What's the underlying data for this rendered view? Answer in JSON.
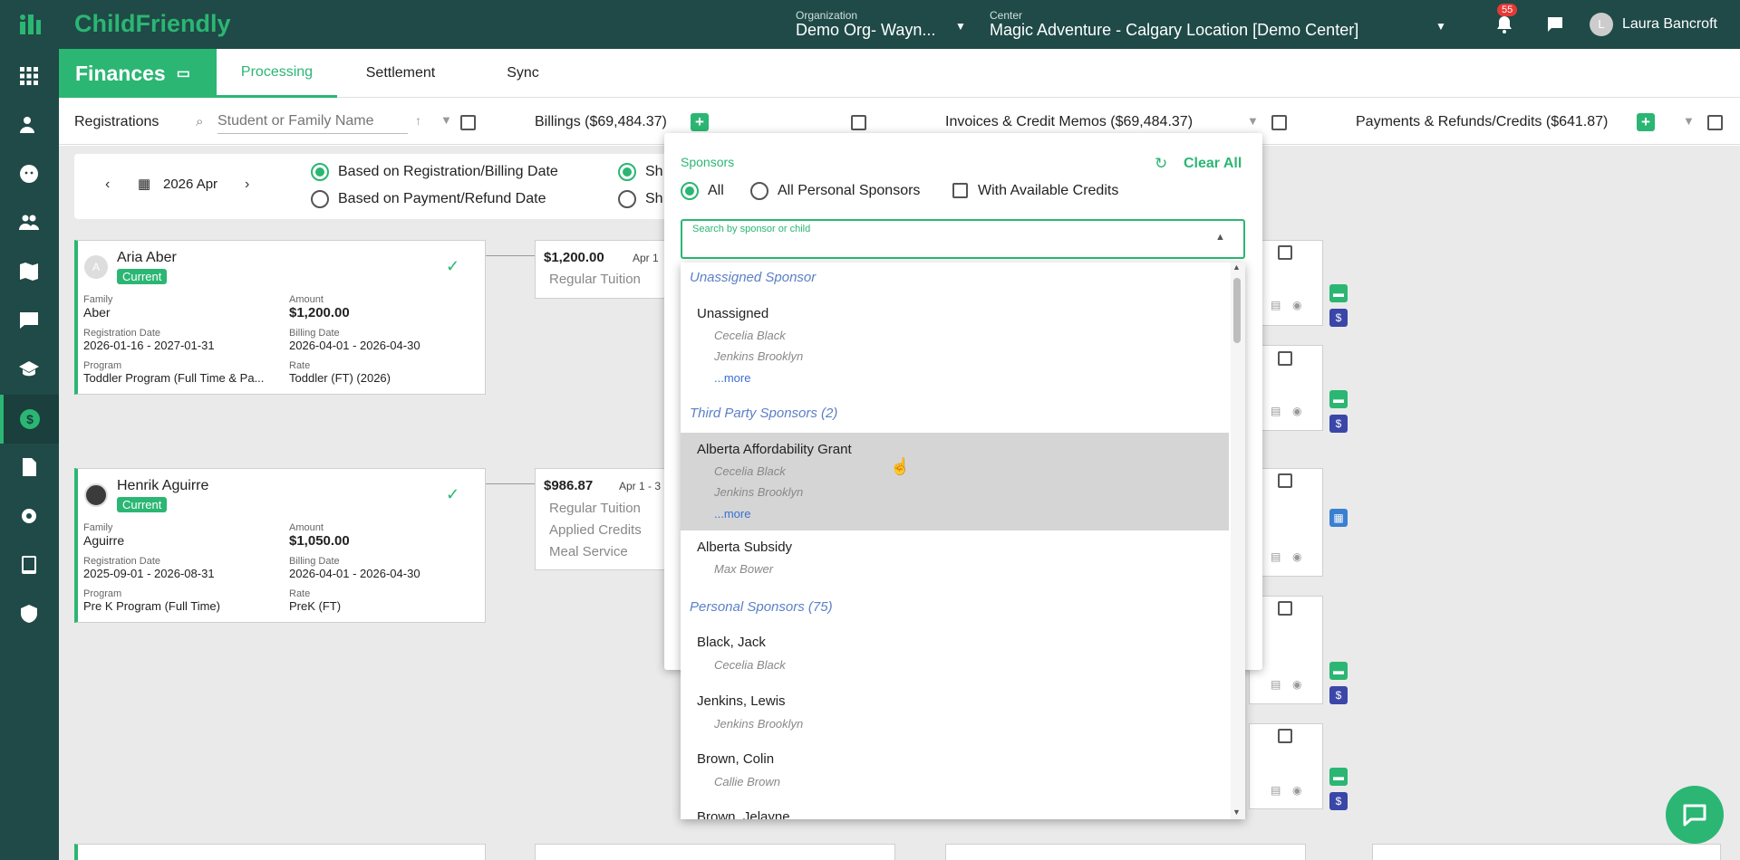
{
  "app": {
    "logo": "ChildFriendly",
    "org_label": "Organization",
    "org_value": "Demo Org- Wayn...",
    "center_label": "Center",
    "center_value": "Magic Adventure - Calgary Location [Demo Center]",
    "notif_count": "55",
    "user_initial": "L",
    "user_name": "Laura Bancroft"
  },
  "colors": {
    "brand": "#2bb673",
    "nav_bg": "#1f4a47",
    "link": "#3a6fd0"
  },
  "section": {
    "title": "Finances",
    "tabs": [
      "Processing",
      "Settlement",
      "Sync"
    ]
  },
  "filters": {
    "registrations": "Registrations",
    "search_placeholder": "Student or Family Name",
    "billings": "Billings ($69,484.37)",
    "invoices": "Invoices & Credit Memos ($69,484.37)",
    "payments": "Payments & Refunds/Credits ($641.87)"
  },
  "period": {
    "month": "2026 Apr",
    "opt1": "Based on Registration/Billing Date",
    "opt2": "Based on Payment/Refund Date",
    "opt3": "Sh",
    "opt4": "Sh"
  },
  "cards": [
    {
      "initial": "A",
      "name": "Aria Aber",
      "status": "Current",
      "family_lbl": "Family",
      "family": "Aber",
      "amount_lbl": "Amount",
      "amount": "$1,200.00",
      "regdate_lbl": "Registration Date",
      "regdate": "2026-01-16 - 2027-01-31",
      "billdate_lbl": "Billing Date",
      "billdate": "2026-04-01 - 2026-04-30",
      "program_lbl": "Program",
      "program": "Toddler Program (Full Time & Pa...",
      "rate_lbl": "Rate",
      "rate": "Toddler (FT) (2026)"
    },
    {
      "initial": "",
      "name": "Henrik Aguirre",
      "status": "Current",
      "family_lbl": "Family",
      "family": "Aguirre",
      "amount_lbl": "Amount",
      "amount": "$1,050.00",
      "regdate_lbl": "Registration Date",
      "regdate": "2025-09-01 - 2026-08-31",
      "billdate_lbl": "Billing Date",
      "billdate": "2026-04-01 - 2026-04-30",
      "program_lbl": "Program",
      "program": "Pre K Program (Full Time)",
      "rate_lbl": "Rate",
      "rate": "PreK (FT)"
    }
  ],
  "billings": [
    {
      "amount": "$1,200.00",
      "date": "Apr 1",
      "lines": [
        "Regular Tuition"
      ]
    },
    {
      "amount": "$986.87",
      "date": "Apr 1 - 3",
      "lines": [
        "Regular Tuition",
        "Applied Credits",
        "Meal Service"
      ]
    }
  ],
  "popup": {
    "title": "Sponsors",
    "clear_all": "Clear All",
    "radio_all": "All",
    "radio_personal": "All Personal Sponsors",
    "check_credits": "With Available Credits",
    "search_label": "Search by sponsor or child"
  },
  "dropdown": {
    "groups": [
      {
        "label": "Unassigned Sponsor"
      },
      {
        "label": "Third Party Sponsors (2)"
      },
      {
        "label": "Personal Sponsors (75)"
      }
    ],
    "options": [
      {
        "name": "Unassigned",
        "children": [
          "Cecelia Black",
          "Jenkins Brooklyn"
        ],
        "more": "...more"
      },
      {
        "name": "Alberta Affordability Grant",
        "children": [
          "Cecelia Black",
          "Jenkins Brooklyn"
        ],
        "more": "...more"
      },
      {
        "name": "Alberta Subsidy",
        "children": [
          "Max Bower"
        ]
      },
      {
        "name": "Black, Jack",
        "children": [
          "Cecelia Black"
        ]
      },
      {
        "name": "Jenkins, Lewis",
        "children": [
          "Jenkins Brooklyn"
        ]
      },
      {
        "name": "Brown, Colin",
        "children": [
          "Callie Brown"
        ]
      },
      {
        "name": "Brown, Jelayne",
        "children": []
      }
    ]
  }
}
